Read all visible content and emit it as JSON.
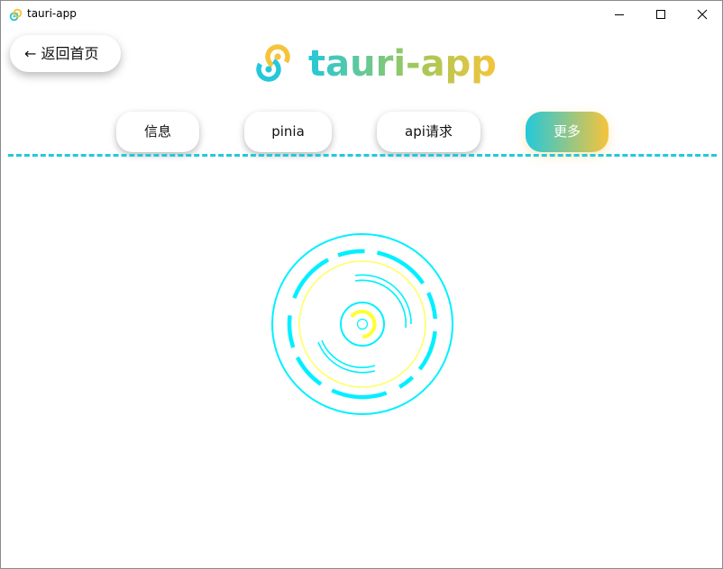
{
  "window": {
    "title": "tauri-app",
    "icon": "tauri-logo-icon",
    "controls": [
      "minimize-icon",
      "maximize-icon",
      "close-icon"
    ]
  },
  "header": {
    "back_label": "← 返回首页",
    "app_name": "tauri-app",
    "logo": "tauri-logo-icon"
  },
  "tabs": [
    {
      "label": "信息",
      "active": false
    },
    {
      "label": "pinia",
      "active": false
    },
    {
      "label": "api请求",
      "active": false
    },
    {
      "label": "更多",
      "active": true
    }
  ],
  "colors": {
    "brand_cyan": "#24c8db",
    "brand_yellow": "#f6c43b",
    "loader_cyan": "#00f0ff",
    "loader_yellow": "#ffff66"
  },
  "main": {
    "loader": "spinner-rings-icon"
  }
}
